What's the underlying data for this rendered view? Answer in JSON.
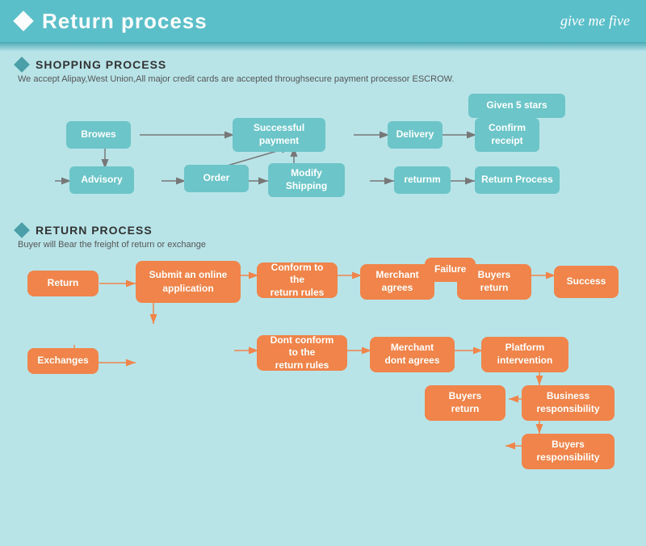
{
  "header": {
    "title": "Return process",
    "brand": "give me five"
  },
  "shopping": {
    "section_title": "SHOPPING PROCESS",
    "desc": "We accept Alipay,West Union,All major credit cards are accepted throughsecure payment processor ESCROW.",
    "nodes": {
      "browes": "Browes",
      "order": "Order",
      "advisory": "Advisory",
      "modify_shipping": "Modify\nShipping",
      "returnm": "returnm",
      "return_process": "Return Process",
      "successful_payment": "Successful\npayment",
      "delivery": "Delivery",
      "confirm_receipt": "Confirm\nreceipt",
      "given_5_stars": "Given 5 stars"
    }
  },
  "return": {
    "section_title": "RETURN PROCESS",
    "desc": "Buyer will Bear the freight of return or exchange",
    "nodes": {
      "return": "Return",
      "exchanges": "Exchanges",
      "submit_online": "Submit an online\napplication",
      "conform_rules": "Conform to the\nreturn rules",
      "dont_conform_rules": "Dont conform to the\nreturn rules",
      "merchant_agrees": "Merchant\nagrees",
      "merchant_dont_agrees": "Merchant\ndont agrees",
      "buyers_return1": "Buyers\nreturn",
      "buyers_return2": "Buyers\nreturn",
      "platform_intervention": "Platform\nintervention",
      "success": "Success",
      "business_responsibility": "Business\nresponsibility",
      "buyers_responsibility": "Buyers\nresponsibility",
      "failure": "Failure"
    }
  }
}
